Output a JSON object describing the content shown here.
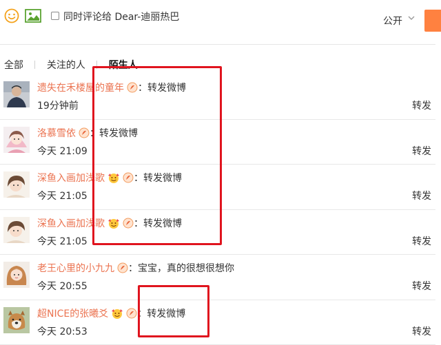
{
  "composer": {
    "cc_label": "同时评论给 Dear-迪丽热巴",
    "visibility": "公开"
  },
  "tabs": [
    {
      "label": "全部",
      "active": false
    },
    {
      "label": "关注的人",
      "active": false
    },
    {
      "label": "陌生人",
      "active": true
    }
  ],
  "items": [
    {
      "name": "遗失在禾楼屋的童年",
      "comment": "：转发微博",
      "time": "19分钟前",
      "action": "转发",
      "badges": [
        "weibo-level-icon"
      ]
    },
    {
      "name": "洛慕雪依",
      "comment": "：转发微博",
      "time": "今天 21:09",
      "action": "转发",
      "badges": [
        "weibo-level-icon"
      ]
    },
    {
      "name": "深鱼入画加浅歌",
      "comment": "：转发微博",
      "time": "今天 21:05",
      "action": "转发",
      "badges": [
        "emoji-badge-icon",
        "weibo-level-icon"
      ]
    },
    {
      "name": "深鱼入画加浅歌",
      "comment": "：转发微博",
      "time": "今天 21:05",
      "action": "转发",
      "badges": [
        "emoji-badge-icon",
        "weibo-level-icon"
      ]
    },
    {
      "name": "老王心里的小九九",
      "comment": "：宝宝，真的很想很想你",
      "time": "今天 20:55",
      "action": "转发",
      "badges": [
        "weibo-level-icon"
      ]
    },
    {
      "name": "超NICE的张曦爻",
      "comment": "：转发微博",
      "time": "今天 20:53",
      "action": "转发",
      "badges": [
        "emoji-badge-icon",
        "weibo-level-icon"
      ]
    }
  ],
  "colors": {
    "username": "#eb7350",
    "highlight": "#e0141e",
    "accent": "#ff8140"
  }
}
